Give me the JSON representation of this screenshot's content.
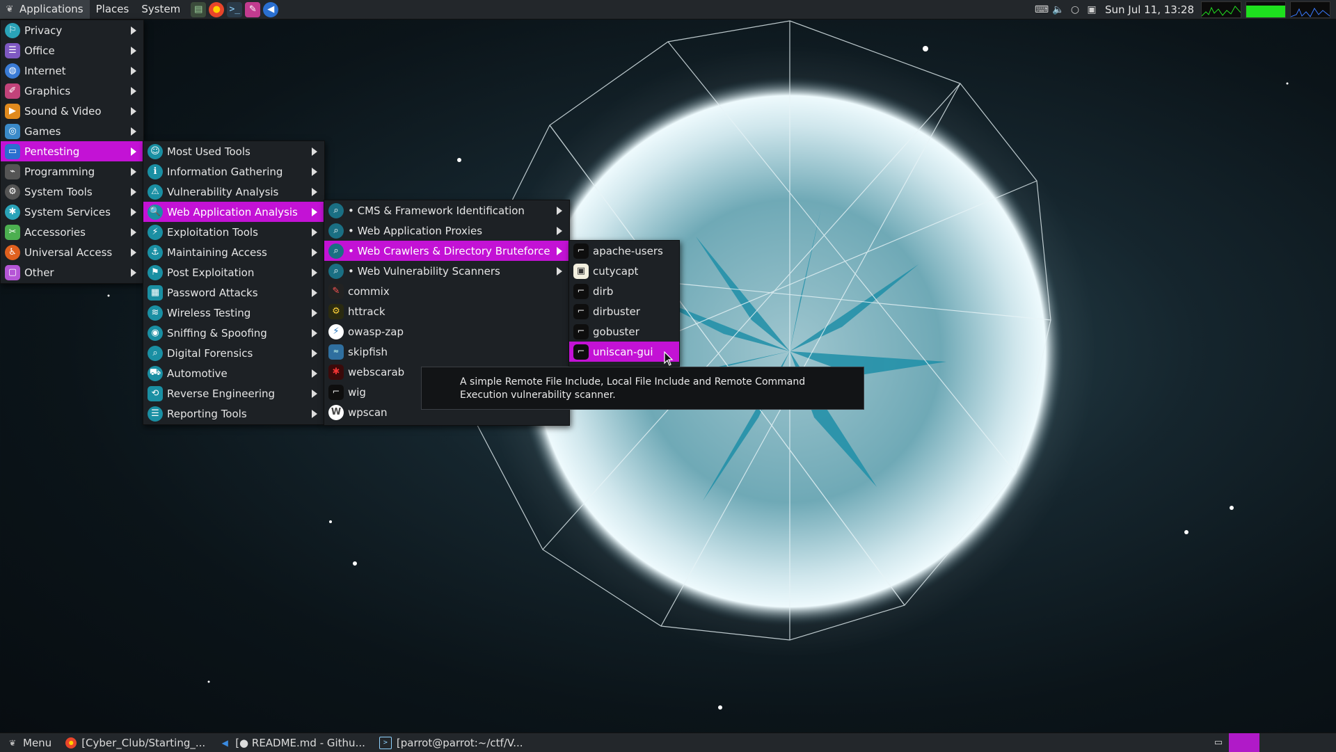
{
  "top_panel": {
    "menus": [
      "Applications",
      "Places",
      "System"
    ],
    "launchers": [
      {
        "icon": "file-manager-icon",
        "color": "#3b4b3b"
      },
      {
        "icon": "firefox-icon",
        "color": "#e8452a"
      },
      {
        "icon": "terminal-icon",
        "color": "#2a3a48"
      },
      {
        "icon": "text-editor-icon",
        "color": "#c23b8f"
      },
      {
        "icon": "vscode-icon",
        "color": "#2a6fd0"
      }
    ],
    "clock": "Sun Jul 11, 13:28"
  },
  "main_menu": {
    "items": [
      {
        "label": "Privacy",
        "icon": "privacy-icon",
        "color": "#2aa3b8"
      },
      {
        "label": "Office",
        "icon": "office-icon",
        "color": "#7e58c2"
      },
      {
        "label": "Internet",
        "icon": "internet-icon",
        "color": "#3a7bd5"
      },
      {
        "label": "Graphics",
        "icon": "graphics-icon",
        "color": "#c2437a"
      },
      {
        "label": "Sound & Video",
        "icon": "sound-video-icon",
        "color": "#e08a1e"
      },
      {
        "label": "Games",
        "icon": "games-icon",
        "color": "#3a8ac9"
      },
      {
        "label": "Pentesting",
        "icon": "pentesting-icon",
        "color": "#2a6fd0",
        "active": true
      },
      {
        "label": "Programming",
        "icon": "programming-icon",
        "color": "#888888"
      },
      {
        "label": "System Tools",
        "icon": "system-tools-icon",
        "color": "#777777"
      },
      {
        "label": "System Services",
        "icon": "system-services-icon",
        "color": "#2aa3b8"
      },
      {
        "label": "Accessories",
        "icon": "accessories-icon",
        "color": "#4caf50"
      },
      {
        "label": "Universal Access",
        "icon": "universal-access-icon",
        "color": "#e0601e"
      },
      {
        "label": "Other",
        "icon": "other-icon",
        "color": "#b555d6"
      }
    ]
  },
  "pentesting_menu": {
    "items": [
      {
        "label": "Most Used Tools",
        "icon": "most-used-icon"
      },
      {
        "label": "Information Gathering",
        "icon": "information-gathering-icon"
      },
      {
        "label": "Vulnerability Analysis",
        "icon": "vulnerability-analysis-icon"
      },
      {
        "label": "Web Application Analysis",
        "icon": "web-application-analysis-icon",
        "active": true
      },
      {
        "label": "Exploitation Tools",
        "icon": "exploitation-tools-icon"
      },
      {
        "label": "Maintaining Access",
        "icon": "maintaining-access-icon"
      },
      {
        "label": "Post Exploitation",
        "icon": "post-exploitation-icon"
      },
      {
        "label": "Password Attacks",
        "icon": "password-attacks-icon"
      },
      {
        "label": "Wireless Testing",
        "icon": "wireless-testing-icon"
      },
      {
        "label": "Sniffing & Spoofing",
        "icon": "sniffing-spoofing-icon"
      },
      {
        "label": "Digital Forensics",
        "icon": "digital-forensics-icon"
      },
      {
        "label": "Automotive",
        "icon": "automotive-icon"
      },
      {
        "label": "Reverse Engineering",
        "icon": "reverse-engineering-icon"
      },
      {
        "label": "Reporting Tools",
        "icon": "reporting-tools-icon"
      }
    ]
  },
  "webapp_menu": {
    "items": [
      {
        "label": "• CMS & Framework Identification",
        "icon": "magnifier-icon",
        "submenu": true
      },
      {
        "label": "• Web Application Proxies",
        "icon": "magnifier-icon",
        "submenu": true
      },
      {
        "label": "• Web Crawlers & Directory Bruteforce",
        "icon": "magnifier-icon",
        "submenu": true,
        "active": true
      },
      {
        "label": "• Web Vulnerability Scanners",
        "icon": "magnifier-icon",
        "submenu": true
      },
      {
        "label": "commix",
        "icon": "commix-icon"
      },
      {
        "label": "httrack",
        "icon": "httrack-icon"
      },
      {
        "label": "owasp-zap",
        "icon": "owasp-zap-icon"
      },
      {
        "label": "skipfish",
        "icon": "skipfish-icon"
      },
      {
        "label": "webscarab",
        "icon": "webscarab-icon"
      },
      {
        "label": "wig",
        "icon": "wig-icon"
      },
      {
        "label": "wpscan",
        "icon": "wordpress-icon"
      }
    ]
  },
  "crawlers_menu": {
    "items": [
      {
        "label": "apache-users",
        "icon": "parrot-tool-icon"
      },
      {
        "label": "cutycapt",
        "icon": "cutycapt-icon"
      },
      {
        "label": "dirb",
        "icon": "parrot-tool-icon"
      },
      {
        "label": "dirbuster",
        "icon": "parrot-tool-icon"
      },
      {
        "label": "gobuster",
        "icon": "parrot-tool-icon"
      },
      {
        "label": "uniscan-gui",
        "icon": "parrot-tool-icon",
        "active": true
      }
    ]
  },
  "tooltip": {
    "text": "A simple Remote File Include, Local File Include and Remote Command Execution vulnerability scanner."
  },
  "taskbar": {
    "menu_label": "Menu",
    "items": [
      {
        "label": "[Cyber_Club/Starting_...",
        "icon": "firefox-icon"
      },
      {
        "label": "[● README.md - Githu...",
        "icon": "vscode-icon"
      },
      {
        "label": "[parrot@parrot:~/ctf/V...",
        "icon": "terminal-icon"
      }
    ]
  },
  "colors": {
    "accent": "#c312d5",
    "panel": "#23272b",
    "menu_bg": "#1d2125"
  }
}
